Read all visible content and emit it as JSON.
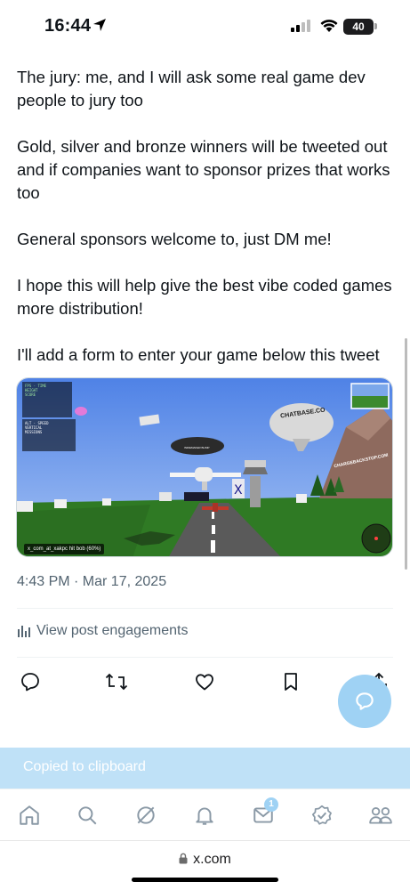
{
  "status_bar": {
    "time": "16:44",
    "battery": "40"
  },
  "tweet": {
    "paragraphs": [
      "The jury: me, and I will ask some real game dev people to jury too",
      "Gold, silver and bronze winners will be tweeted out and if companies want to sponsor prizes that works too",
      "General sponsors welcome to, just DM me!",
      "I hope this will help give the best vibe coded games more distribution!",
      "I'll add a form to enter your game below this tweet"
    ],
    "timestamp": "4:43 PM · Mar 17, 2025",
    "engagements_label": "View post engagements"
  },
  "media": {
    "balloon_text": "CHATBASE.CO",
    "mountain_text": "CHARGEBACKSTOP.COM",
    "blimp_text": "INDIEMAKER BLIMP",
    "kill_feed": {
      "killer": "x_com_at_xakpc",
      "verb": "hit",
      "victim": "bob",
      "detail": "(60%)"
    }
  },
  "actions": [
    "reply-icon",
    "repost-icon",
    "like-icon",
    "bookmark-icon",
    "share-icon"
  ],
  "toast": {
    "text": "Copied to clipboard"
  },
  "tabbar": {
    "items": [
      "home-icon",
      "search-icon",
      "grok-icon",
      "notifications-icon",
      "messages-icon",
      "verified-icon",
      "communities-icon"
    ],
    "messages_badge": "1"
  },
  "browser": {
    "url": "x.com"
  },
  "colors": {
    "text": "#0f1419",
    "secondary": "#536471",
    "accent_faded": "#9fd2f4",
    "toast_bg": "#bfe1f7"
  }
}
